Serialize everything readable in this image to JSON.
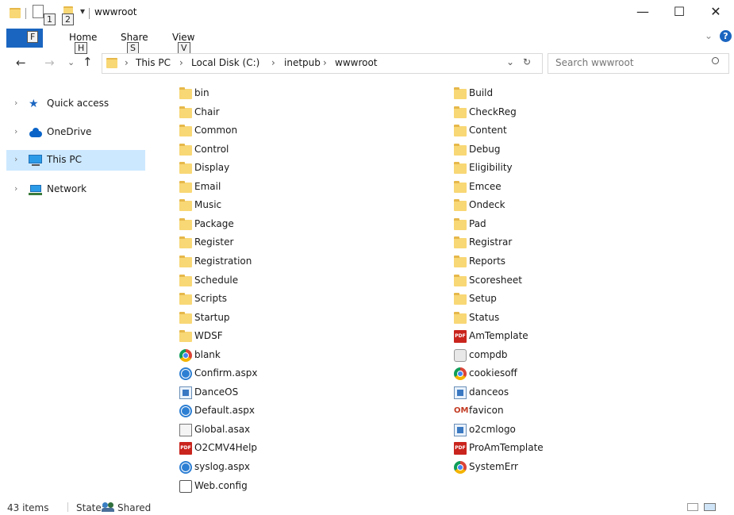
{
  "window": {
    "title": "wwwroot",
    "controls": {
      "minimize": "—",
      "maximize": "☐",
      "close": "✕"
    }
  },
  "quick_access_toolbar": {
    "badges": [
      "1",
      "2"
    ],
    "dropdown": "▾"
  },
  "ribbon": {
    "file_label": "F",
    "tabs": [
      {
        "label": "Home",
        "key": "H"
      },
      {
        "label": "Share",
        "key": "S"
      },
      {
        "label": "View",
        "key": "V"
      }
    ]
  },
  "address_bar": {
    "path": [
      "This PC",
      "Local Disk (C:)",
      "inetpub",
      "wwwroot"
    ],
    "separator": "›",
    "dropdown": "⌄",
    "refresh": "↻"
  },
  "search": {
    "placeholder": "Search wwwroot",
    "icon": "search-icon"
  },
  "navigation": {
    "items": [
      {
        "label": "Quick access",
        "icon": "star-icon"
      },
      {
        "label": "OneDrive",
        "icon": "cloud-icon"
      },
      {
        "label": "This PC",
        "icon": "computer-icon",
        "selected": true
      },
      {
        "label": "Network",
        "icon": "network-icon"
      }
    ]
  },
  "files": {
    "col1": [
      {
        "name": "bin",
        "type": "folder"
      },
      {
        "name": "Chair",
        "type": "folder"
      },
      {
        "name": "Common",
        "type": "folder"
      },
      {
        "name": "Control",
        "type": "folder"
      },
      {
        "name": "Display",
        "type": "folder"
      },
      {
        "name": "Email",
        "type": "folder"
      },
      {
        "name": "Music",
        "type": "folder"
      },
      {
        "name": "Package",
        "type": "folder"
      },
      {
        "name": "Register",
        "type": "folder"
      },
      {
        "name": "Registration",
        "type": "folder"
      },
      {
        "name": "Schedule",
        "type": "folder"
      },
      {
        "name": "Scripts",
        "type": "folder"
      },
      {
        "name": "Startup",
        "type": "folder"
      },
      {
        "name": "WDSF",
        "type": "folder"
      },
      {
        "name": "blank",
        "type": "chrome"
      },
      {
        "name": "Confirm.aspx",
        "type": "globe"
      },
      {
        "name": "DanceOS",
        "type": "image"
      },
      {
        "name": "Default.aspx",
        "type": "globe"
      },
      {
        "name": "Global.asax",
        "type": "asax"
      },
      {
        "name": "O2CMV4Help",
        "type": "pdf"
      },
      {
        "name": "syslog.aspx",
        "type": "globe"
      },
      {
        "name": "Web.config",
        "type": "config"
      }
    ],
    "col2": [
      {
        "name": "Build",
        "type": "folder"
      },
      {
        "name": "CheckReg",
        "type": "folder"
      },
      {
        "name": "Content",
        "type": "folder"
      },
      {
        "name": "Debug",
        "type": "folder"
      },
      {
        "name": "Eligibility",
        "type": "folder"
      },
      {
        "name": "Emcee",
        "type": "folder"
      },
      {
        "name": "Ondeck",
        "type": "folder"
      },
      {
        "name": "Pad",
        "type": "folder"
      },
      {
        "name": "Registrar",
        "type": "folder"
      },
      {
        "name": "Reports",
        "type": "folder"
      },
      {
        "name": "Scoresheet",
        "type": "folder"
      },
      {
        "name": "Setup",
        "type": "folder"
      },
      {
        "name": "Status",
        "type": "folder"
      },
      {
        "name": "AmTemplate",
        "type": "pdf"
      },
      {
        "name": "compdb",
        "type": "dll"
      },
      {
        "name": "cookiesoff",
        "type": "chrome"
      },
      {
        "name": "danceos",
        "type": "image"
      },
      {
        "name": "favicon",
        "type": "favicon"
      },
      {
        "name": "o2cmlogo",
        "type": "image"
      },
      {
        "name": "ProAmTemplate",
        "type": "pdf"
      },
      {
        "name": "SystemErr",
        "type": "chrome"
      }
    ]
  },
  "status_bar": {
    "count": "43 items",
    "state_label": "State:",
    "state_value": "Shared"
  },
  "colors": {
    "accent": "#1a65c0",
    "selection": "#cce8ff",
    "folder": "#f8d775"
  }
}
